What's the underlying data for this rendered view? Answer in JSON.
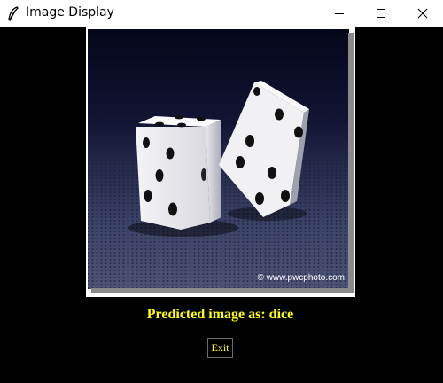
{
  "window": {
    "title": "Image Display",
    "controls": [
      "minimize",
      "maximize",
      "close"
    ]
  },
  "image": {
    "subject": "two white dice with black pips",
    "watermark": "© www.pwcphoto.com"
  },
  "prediction": {
    "text": "Predicted image as: dice",
    "color": "#ffff00"
  },
  "exit_button": {
    "label": "Exit"
  },
  "colors": {
    "background": "#000000",
    "titlebar": "#ffffff",
    "accent": "#ffff00"
  }
}
